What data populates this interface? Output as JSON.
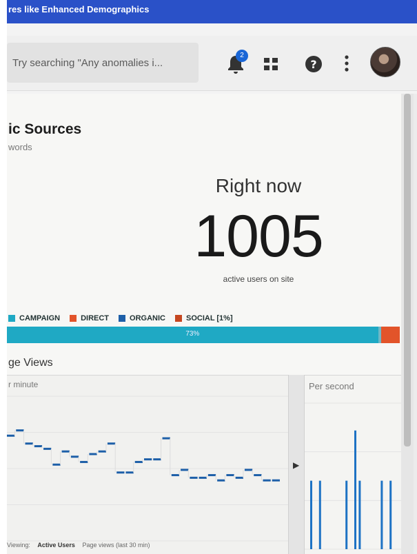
{
  "banner": {
    "text": "res like Enhanced Demographics"
  },
  "header": {
    "search_placeholder": "Try searching \"Any anomalies i...",
    "notifications_count": "2"
  },
  "card": {
    "title": "ic Sources",
    "subtitle": "words"
  },
  "realtime": {
    "label": "Right now",
    "value": "1005",
    "caption": "active users on site"
  },
  "legend": [
    {
      "label": "CAMPAIGN",
      "color": "#1fa9c4"
    },
    {
      "label": "DIRECT",
      "color": "#e2542a"
    },
    {
      "label": "ORGANIC",
      "color": "#1d5fa8"
    },
    {
      "label": "SOCIAL [1%]",
      "color": "#c5461f"
    }
  ],
  "share_bar": [
    {
      "label": "73%",
      "fraction": 0.945,
      "color": "#1fa9c4"
    },
    {
      "label": "",
      "fraction": 0.008,
      "color": "#6fb8c6"
    },
    {
      "label": "",
      "fraction": 0.047,
      "color": "#e2542a"
    }
  ],
  "page_views": {
    "title": "ge Views",
    "per_minute_label": "r minute",
    "per_second_label": "Per second"
  },
  "footer": {
    "items": [
      "Viewing:",
      "Active Users",
      "Page views (last 30 min)"
    ]
  },
  "chart_data": [
    {
      "type": "line",
      "title": "",
      "x": [
        1,
        2,
        3,
        4,
        5,
        6,
        7,
        8,
        9,
        10,
        11,
        12,
        13,
        14,
        15,
        16,
        17,
        18,
        19,
        20,
        21,
        22,
        23,
        24,
        25,
        26,
        27,
        28,
        29,
        30
      ],
      "values": [
        40,
        42,
        37,
        36,
        35,
        29,
        34,
        32,
        30,
        33,
        34,
        37,
        26,
        26,
        30,
        31,
        31,
        39,
        25,
        27,
        24,
        24,
        25,
        23,
        25,
        24,
        27,
        25,
        23,
        23
      ],
      "color": "#1d5fa8",
      "ylim": [
        0,
        55
      ]
    },
    {
      "type": "bar",
      "title": "",
      "x": [
        1,
        2,
        3,
        4,
        5,
        6,
        7,
        8,
        9,
        10,
        11,
        12,
        13,
        14,
        15,
        16,
        17,
        18,
        19,
        20
      ],
      "values": [
        1.5,
        0,
        1.5,
        0,
        0,
        0,
        0,
        0,
        1.5,
        0,
        2.6,
        1.5,
        0,
        0,
        0,
        0,
        1.5,
        0,
        1.5,
        0
      ],
      "color": "#1d72c4",
      "ylim": [
        0,
        3.2
      ]
    }
  ]
}
